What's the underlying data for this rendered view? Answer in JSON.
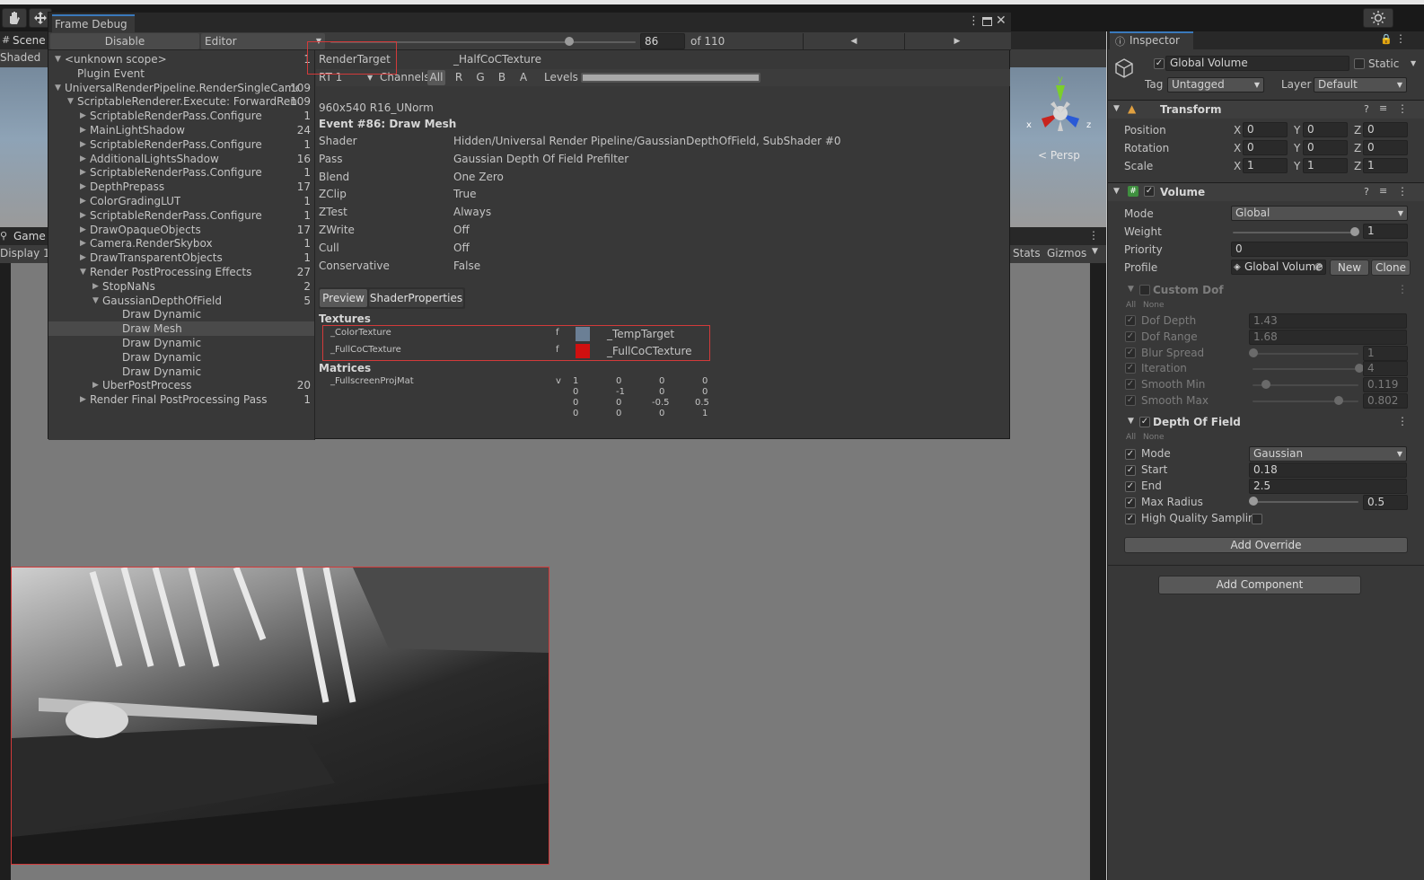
{
  "toolbar": {
    "hand_icon": "hand-icon",
    "move_icon": "move-icon",
    "settings_icon": "sun-gear-icon"
  },
  "scene": {
    "tab": "Scene",
    "shading": "Shaded",
    "persp": "< Persp",
    "gizmo_y": "y",
    "gizmo_x": "x",
    "gizmo_z": "z"
  },
  "game": {
    "tab": "Game",
    "display": "Display 1",
    "stats": "Stats",
    "gizmos": "Gizmos"
  },
  "frame_debug": {
    "title": "Frame Debug",
    "disable_label": "Disable",
    "mode": "Editor",
    "event_current": "86",
    "event_total": "of 110",
    "tree": [
      {
        "label": "<unknown scope>",
        "count": "1",
        "indent": 0,
        "arrow": "down"
      },
      {
        "label": "Plugin Event",
        "count": "",
        "indent": 1,
        "arrow": ""
      },
      {
        "label": "UniversalRenderPipeline.RenderSingleCamera",
        "count": "109",
        "indent": 0,
        "arrow": "down"
      },
      {
        "label": "ScriptableRenderer.Execute: ForwardRenderer",
        "count": "109",
        "indent": 1,
        "arrow": "down"
      },
      {
        "label": "ScriptableRenderPass.Configure",
        "count": "1",
        "indent": 2,
        "arrow": "right"
      },
      {
        "label": "MainLightShadow",
        "count": "24",
        "indent": 2,
        "arrow": "right"
      },
      {
        "label": "ScriptableRenderPass.Configure",
        "count": "1",
        "indent": 2,
        "arrow": "right"
      },
      {
        "label": "AdditionalLightsShadow",
        "count": "16",
        "indent": 2,
        "arrow": "right"
      },
      {
        "label": "ScriptableRenderPass.Configure",
        "count": "1",
        "indent": 2,
        "arrow": "right"
      },
      {
        "label": "DepthPrepass",
        "count": "17",
        "indent": 2,
        "arrow": "right"
      },
      {
        "label": "ColorGradingLUT",
        "count": "1",
        "indent": 2,
        "arrow": "right"
      },
      {
        "label": "ScriptableRenderPass.Configure",
        "count": "1",
        "indent": 2,
        "arrow": "right"
      },
      {
        "label": "DrawOpaqueObjects",
        "count": "17",
        "indent": 2,
        "arrow": "right"
      },
      {
        "label": "Camera.RenderSkybox",
        "count": "1",
        "indent": 2,
        "arrow": "right"
      },
      {
        "label": "DrawTransparentObjects",
        "count": "1",
        "indent": 2,
        "arrow": "right"
      },
      {
        "label": "Render PostProcessing Effects",
        "count": "27",
        "indent": 2,
        "arrow": "down"
      },
      {
        "label": "StopNaNs",
        "count": "2",
        "indent": 3,
        "arrow": "right"
      },
      {
        "label": "GaussianDepthOfField",
        "count": "5",
        "indent": 3,
        "arrow": "down"
      },
      {
        "label": "Draw Dynamic",
        "count": "",
        "indent": 4,
        "arrow": ""
      },
      {
        "label": "Draw Mesh",
        "count": "",
        "indent": 4,
        "arrow": "",
        "selected": true
      },
      {
        "label": "Draw Dynamic",
        "count": "",
        "indent": 4,
        "arrow": ""
      },
      {
        "label": "Draw Dynamic",
        "count": "",
        "indent": 4,
        "arrow": ""
      },
      {
        "label": "Draw Dynamic",
        "count": "",
        "indent": 4,
        "arrow": ""
      },
      {
        "label": "UberPostProcess",
        "count": "20",
        "indent": 3,
        "arrow": "right"
      },
      {
        "label": "Render Final PostProcessing Pass",
        "count": "1",
        "indent": 2,
        "arrow": "right"
      }
    ],
    "render_target_label": "RenderTarget",
    "render_target_value": "_HalfCoCTexture",
    "rt_select": "RT 1",
    "channels_label": "Channels",
    "channels": [
      "All",
      "R",
      "G",
      "B",
      "A"
    ],
    "levels_label": "Levels",
    "format": "960x540 R16_UNorm",
    "event_title": "Event #86: Draw Mesh",
    "props": [
      {
        "k": "Shader",
        "v": "Hidden/Universal Render Pipeline/GaussianDepthOfField, SubShader #0"
      },
      {
        "k": "Pass",
        "v": "Gaussian Depth Of Field Prefilter"
      },
      {
        "k": "Blend",
        "v": "One Zero"
      },
      {
        "k": "ZClip",
        "v": "True"
      },
      {
        "k": "ZTest",
        "v": "Always"
      },
      {
        "k": "ZWrite",
        "v": "Off"
      },
      {
        "k": "Cull",
        "v": "Off"
      },
      {
        "k": "Conservative",
        "v": "False"
      }
    ],
    "tabs": [
      "Preview",
      "ShaderProperties"
    ],
    "textures_label": "Textures",
    "textures": [
      {
        "name": "_ColorTexture",
        "stage": "f",
        "value": "_TempTarget",
        "thumb": "#6b7f95"
      },
      {
        "name": "_FullCoCTexture",
        "stage": "f",
        "value": "_FullCoCTexture",
        "thumb": "#d01010"
      }
    ],
    "matrices_label": "Matrices",
    "matrix_name": "_FullscreenProjMat",
    "matrix_stage": "v",
    "matrix": [
      [
        "1",
        "0",
        "0",
        "0"
      ],
      [
        "0",
        "-1",
        "0",
        "0"
      ],
      [
        "0",
        "0",
        "-0.5",
        "0.5"
      ],
      [
        "0",
        "0",
        "0",
        "1"
      ]
    ]
  },
  "inspector": {
    "tab": "Inspector",
    "object_name": "Global Volume",
    "static_label": "Static",
    "tag_label": "Tag",
    "tag": "Untagged",
    "layer_label": "Layer",
    "layer": "Default",
    "transform": {
      "title": "Transform",
      "rows": [
        {
          "k": "Position",
          "x": "0",
          "y": "0",
          "z": "0"
        },
        {
          "k": "Rotation",
          "x": "0",
          "y": "0",
          "z": "0"
        },
        {
          "k": "Scale",
          "x": "1",
          "y": "1",
          "z": "1"
        }
      ]
    },
    "volume": {
      "title": "Volume",
      "mode_label": "Mode",
      "mode": "Global",
      "weight_label": "Weight",
      "weight": "1",
      "priority_label": "Priority",
      "priority": "0",
      "profile_label": "Profile",
      "profile": "Global Volume",
      "new_label": "New",
      "clone_label": "Clone"
    },
    "custom_dof": {
      "title": "Custom Dof",
      "all": "All",
      "none": "None",
      "rows": [
        {
          "k": "Dof Depth",
          "v": "1.43",
          "slider": false
        },
        {
          "k": "Dof Range",
          "v": "1.68",
          "slider": false
        },
        {
          "k": "Blur Spread",
          "v": "1",
          "slider": true,
          "pos": 0
        },
        {
          "k": "Iteration",
          "v": "4",
          "slider": true,
          "pos": 1
        },
        {
          "k": "Smooth Min",
          "v": "0.119",
          "slider": true,
          "pos": 0.119
        },
        {
          "k": "Smooth Max",
          "v": "0.802",
          "slider": true,
          "pos": 0.802
        }
      ]
    },
    "dof": {
      "title": "Depth Of Field",
      "all": "All",
      "none": "None",
      "mode_label": "Mode",
      "mode": "Gaussian",
      "start_label": "Start",
      "start": "0.18",
      "end_label": "End",
      "end": "2.5",
      "maxr_label": "Max Radius",
      "maxr": "0.5",
      "hq_label": "High Quality Sampling"
    },
    "add_override": "Add Override",
    "add_component": "Add Component",
    "axis_x": "X",
    "axis_y": "Y",
    "axis_z": "Z"
  }
}
